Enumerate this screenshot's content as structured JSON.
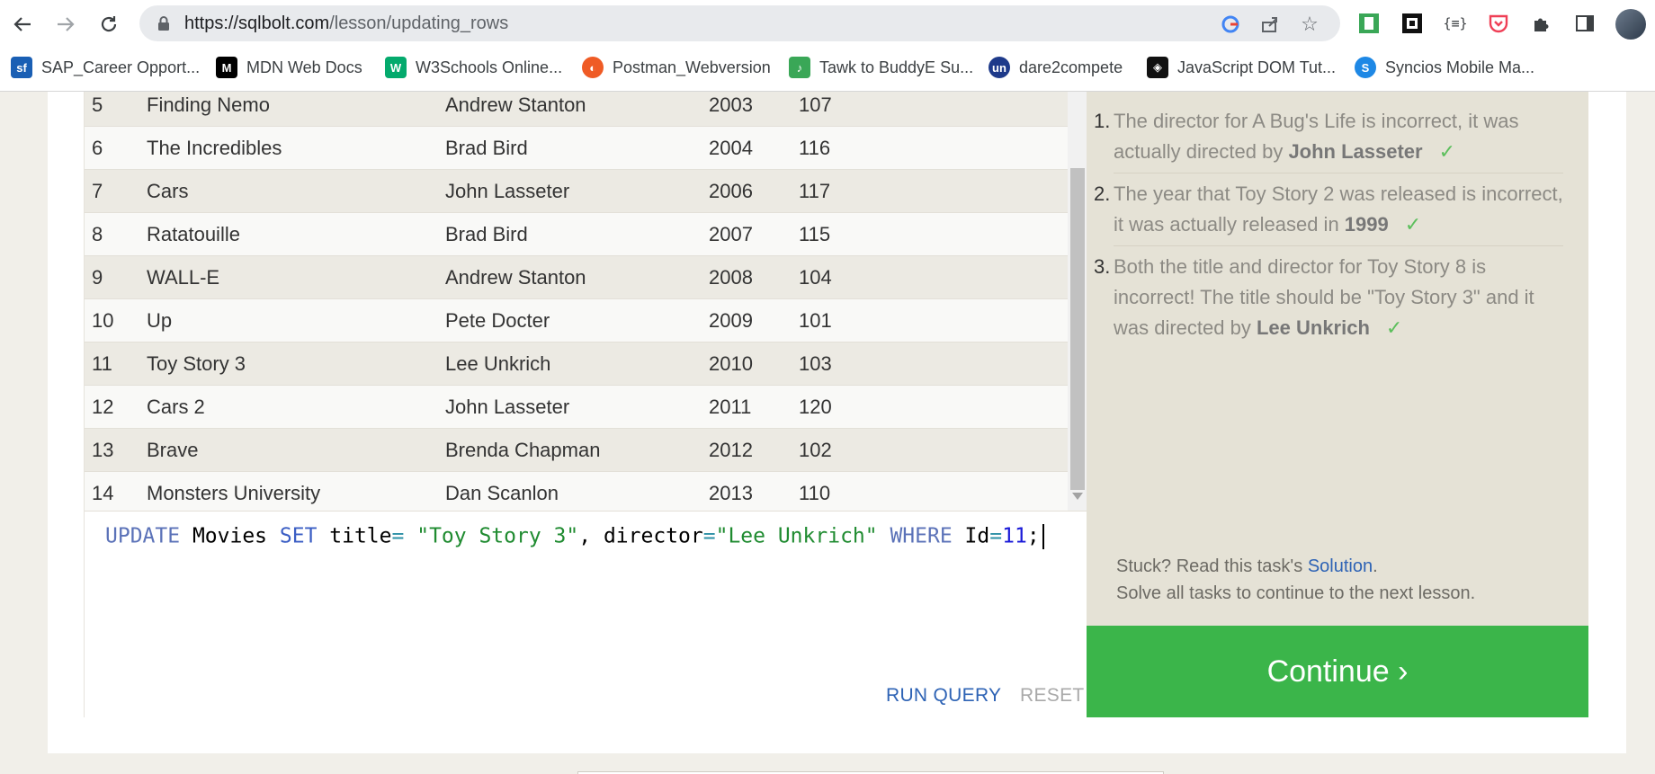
{
  "browser": {
    "url_host": "https://sqlbolt.com",
    "url_path": "/lesson/updating_rows",
    "bookmarks": [
      {
        "label": "SAP_Career Opport...",
        "icon": "sap-icon",
        "color": "#1a5fb4",
        "glyph": "sf"
      },
      {
        "label": "MDN Web Docs",
        "icon": "mdn-icon",
        "color": "#000000",
        "glyph": "M"
      },
      {
        "label": "W3Schools Online...",
        "icon": "w3schools-icon",
        "color": "#04aa6d",
        "glyph": "W"
      },
      {
        "label": "Postman_Webversion",
        "icon": "postman-icon",
        "color": "#ef5b25",
        "glyph": "◐"
      },
      {
        "label": "Tawk to BuddyE Su...",
        "icon": "tawk-icon",
        "color": "#3aa757",
        "glyph": "♪"
      },
      {
        "label": "dare2compete",
        "icon": "dare2compete-icon",
        "color": "#1e3a8a",
        "glyph": "un"
      },
      {
        "label": "JavaScript DOM Tut...",
        "icon": "js-dom-icon",
        "color": "#111111",
        "glyph": "◈"
      },
      {
        "label": "Syncios Mobile Ma...",
        "icon": "syncios-icon",
        "color": "#1e88e5",
        "glyph": "S"
      }
    ]
  },
  "table": {
    "rows": [
      {
        "id": "5",
        "title": "Finding Nemo",
        "director": "Andrew Stanton",
        "year": "2003",
        "length": "107"
      },
      {
        "id": "6",
        "title": "The Incredibles",
        "director": "Brad Bird",
        "year": "2004",
        "length": "116"
      },
      {
        "id": "7",
        "title": "Cars",
        "director": "John Lasseter",
        "year": "2006",
        "length": "117"
      },
      {
        "id": "8",
        "title": "Ratatouille",
        "director": "Brad Bird",
        "year": "2007",
        "length": "115"
      },
      {
        "id": "9",
        "title": "WALL-E",
        "director": "Andrew Stanton",
        "year": "2008",
        "length": "104"
      },
      {
        "id": "10",
        "title": "Up",
        "director": "Pete Docter",
        "year": "2009",
        "length": "101"
      },
      {
        "id": "11",
        "title": "Toy Story 3",
        "director": "Lee Unkrich",
        "year": "2010",
        "length": "103"
      },
      {
        "id": "12",
        "title": "Cars 2",
        "director": "John Lasseter",
        "year": "2011",
        "length": "120"
      },
      {
        "id": "13",
        "title": "Brave",
        "director": "Brenda Chapman",
        "year": "2012",
        "length": "102"
      },
      {
        "id": "14",
        "title": "Monsters University",
        "director": "Dan Scanlon",
        "year": "2013",
        "length": "110"
      }
    ]
  },
  "editor": {
    "kw_update": "UPDATE",
    "t_movies": " Movies ",
    "kw_set": "SET",
    "t_title": " title",
    "op_eq1": "=",
    "s_title": " \"Toy Story 3\"",
    "t_comma": ", director",
    "op_eq2": "=",
    "s_director": "\"Lee Unkrich\"",
    "kw_where": " WHERE",
    "t_id": " Id",
    "op_eq3": "=",
    "n_eleven": "11",
    "t_semi": ";",
    "run_label": "RUN QUERY",
    "reset_label": "RESET"
  },
  "tasks": [
    {
      "number": "1.",
      "text": "The director for A Bug's Life is incorrect, it was actually directed by ",
      "bold": "John Lasseter",
      "check": "✓"
    },
    {
      "number": "2.",
      "text": "The year that Toy Story 2 was released is incorrect, it was actually released in ",
      "bold": "1999",
      "check": "✓"
    },
    {
      "number": "3.",
      "text": "Both the title and director for Toy Story 8 is incorrect! The title should be \"Toy Story 3\" and it was directed by ",
      "bold": "Lee Unkrich",
      "check": "✓"
    }
  ],
  "help": {
    "stuck_prefix": "Stuck? Read this task's ",
    "solution_link": "Solution",
    "stuck_suffix": ".",
    "solve_all": "Solve all tasks to continue to the next lesson."
  },
  "continue_label": "Continue ›"
}
